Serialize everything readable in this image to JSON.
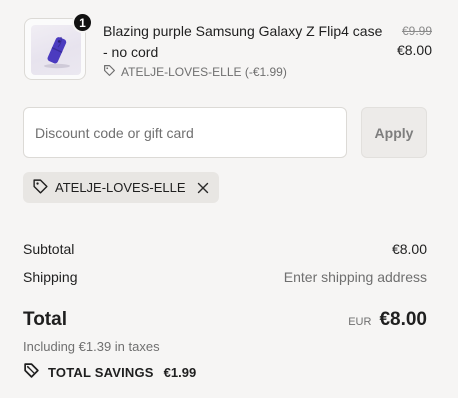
{
  "product": {
    "quantity": "1",
    "title": "Blazing purple Samsung Galaxy Z Flip4 case - no cord",
    "discount_text": "ATELJE-LOVES-ELLE (-€1.99)",
    "price_original": "€9.99",
    "price_final": "€8.00",
    "image_icon": "phone-case-icon",
    "tag_icon": "tag-icon"
  },
  "discount": {
    "placeholder": "Discount code or gift card",
    "value": "",
    "apply_label": "Apply"
  },
  "applied_code": {
    "label": "ATELJE-LOVES-ELLE",
    "tag_icon": "tag-icon",
    "remove_icon": "close-icon"
  },
  "summary": {
    "subtotal_label": "Subtotal",
    "subtotal_value": "€8.00",
    "shipping_label": "Shipping",
    "shipping_value": "Enter shipping address",
    "total_label": "Total",
    "currency": "EUR",
    "total_value": "€8.00",
    "tax_note": "Including €1.39 in taxes",
    "savings_label": "TOTAL SAVINGS",
    "savings_value": "€1.99",
    "savings_icon": "savings-tag-icon"
  },
  "colors": {
    "background": "#f6f5f4",
    "text": "#1f1f1f",
    "muted": "#6f6f6f",
    "badge": "#121212",
    "chip": "#e8e6e3",
    "case": "#4b3bbf"
  }
}
